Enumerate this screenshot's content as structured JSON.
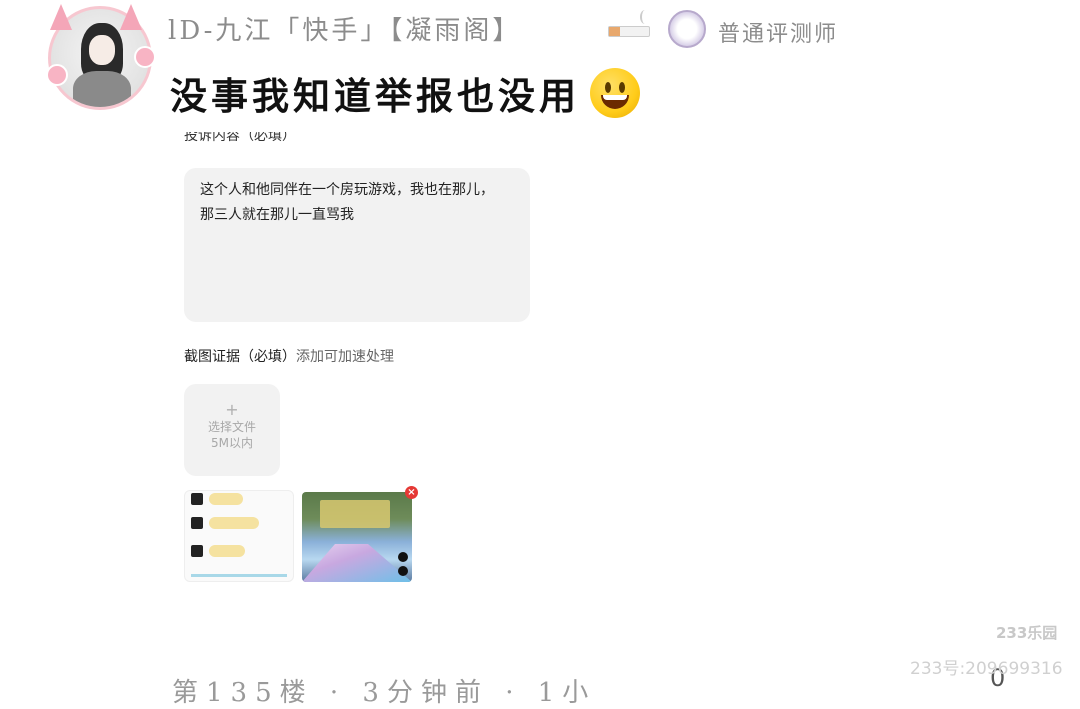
{
  "header": {
    "username": "lD-九江「快手」【凝雨阁】",
    "badge_label": "普通评测师",
    "comment": "没事我知道举报也没用"
  },
  "report_form": {
    "content_label_cut": "投诉内容（必填）",
    "content_text_line1": "这个人和他同伴在一个房玩游戏，我也在那儿，",
    "content_text_line2": "那三人就在那儿一直骂我",
    "screenshot_label": "截图证据（必填）",
    "screenshot_hint": "添加可加速处理",
    "upload_plus": "+",
    "upload_text_line1": "选择文件",
    "upload_text_line2": "5M以内",
    "remove_glyph": "×"
  },
  "footer": {
    "next_floor_cut": "第135楼 · 3分钟前 · 1小",
    "watermark_logo": "233乐园",
    "watermark_id": "233号:209699316",
    "edge_glyph": "0"
  },
  "colors": {
    "background": "#ffffff",
    "field_bg": "#f2f2f2",
    "username_gray": "#8c8c8c",
    "remove_red": "#e53935",
    "avatar_pink": "#f7c7d0"
  }
}
